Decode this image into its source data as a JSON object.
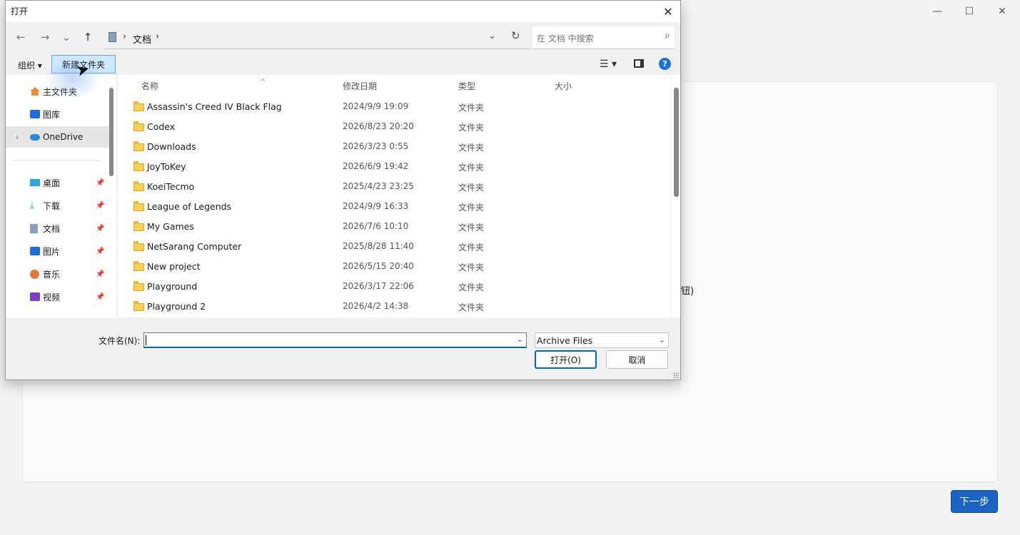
{
  "background_window": {
    "controls": [
      "—",
      "☐",
      "✕"
    ],
    "fragment_text": "钮)",
    "next_button": "下一步"
  },
  "dialog": {
    "title": "打开",
    "close_glyph": "✕",
    "nav": {
      "back": "←",
      "forward": "→",
      "recent": "⌄",
      "up": "↑"
    },
    "address": {
      "crumb": "文档",
      "sep": "›"
    },
    "search": {
      "placeholder": "在 文档 中搜索",
      "icon": "search-icon"
    },
    "toolbar": {
      "organize": "组织 ▾",
      "new_folder": "新建文件夹",
      "help": "?"
    },
    "nav_pane": [
      {
        "label": "主文件夹",
        "icon": "home-icon",
        "pinned": false
      },
      {
        "label": "图库",
        "icon": "gallery-icon",
        "pinned": false
      },
      {
        "label": "OneDrive",
        "icon": "cloud-icon",
        "pinned": false,
        "selected": true
      },
      {
        "label": "桌面",
        "icon": "desktop-icon",
        "pinned": true
      },
      {
        "label": "下载",
        "icon": "download-icon",
        "pinned": true
      },
      {
        "label": "文档",
        "icon": "documents-icon",
        "pinned": true
      },
      {
        "label": "图片",
        "icon": "pictures-icon",
        "pinned": true
      },
      {
        "label": "音乐",
        "icon": "music-icon",
        "pinned": true
      },
      {
        "label": "视频",
        "icon": "video-icon",
        "pinned": true
      }
    ],
    "columns": {
      "name": "名称",
      "date": "修改日期",
      "type": "类型",
      "size": "大小"
    },
    "files": [
      {
        "name": "Assassin's Creed IV Black Flag",
        "date": "2024/9/9 19:09",
        "type": "文件夹"
      },
      {
        "name": "Codex",
        "date": "2026/8/23 20:20",
        "type": "文件夹"
      },
      {
        "name": "Downloads",
        "date": "2026/3/23 0:55",
        "type": "文件夹"
      },
      {
        "name": "JoyToKey",
        "date": "2026/6/9 19:42",
        "type": "文件夹"
      },
      {
        "name": "KoeiTecmo",
        "date": "2025/4/23 23:25",
        "type": "文件夹"
      },
      {
        "name": "League of Legends",
        "date": "2024/9/9 16:33",
        "type": "文件夹"
      },
      {
        "name": "My Games",
        "date": "2026/7/6 10:10",
        "type": "文件夹"
      },
      {
        "name": "NetSarang Computer",
        "date": "2025/8/28 11:40",
        "type": "文件夹"
      },
      {
        "name": "New project",
        "date": "2026/5/15 20:40",
        "type": "文件夹"
      },
      {
        "name": "Playground",
        "date": "2026/3/17 22:06",
        "type": "文件夹"
      },
      {
        "name": "Playground 2",
        "date": "2026/4/2 14:38",
        "type": "文件夹"
      }
    ],
    "filename": {
      "label": "文件名(N):",
      "value": ""
    },
    "filetype": "Archive Files",
    "open_button": "打开(O)",
    "cancel_button": "取消"
  }
}
